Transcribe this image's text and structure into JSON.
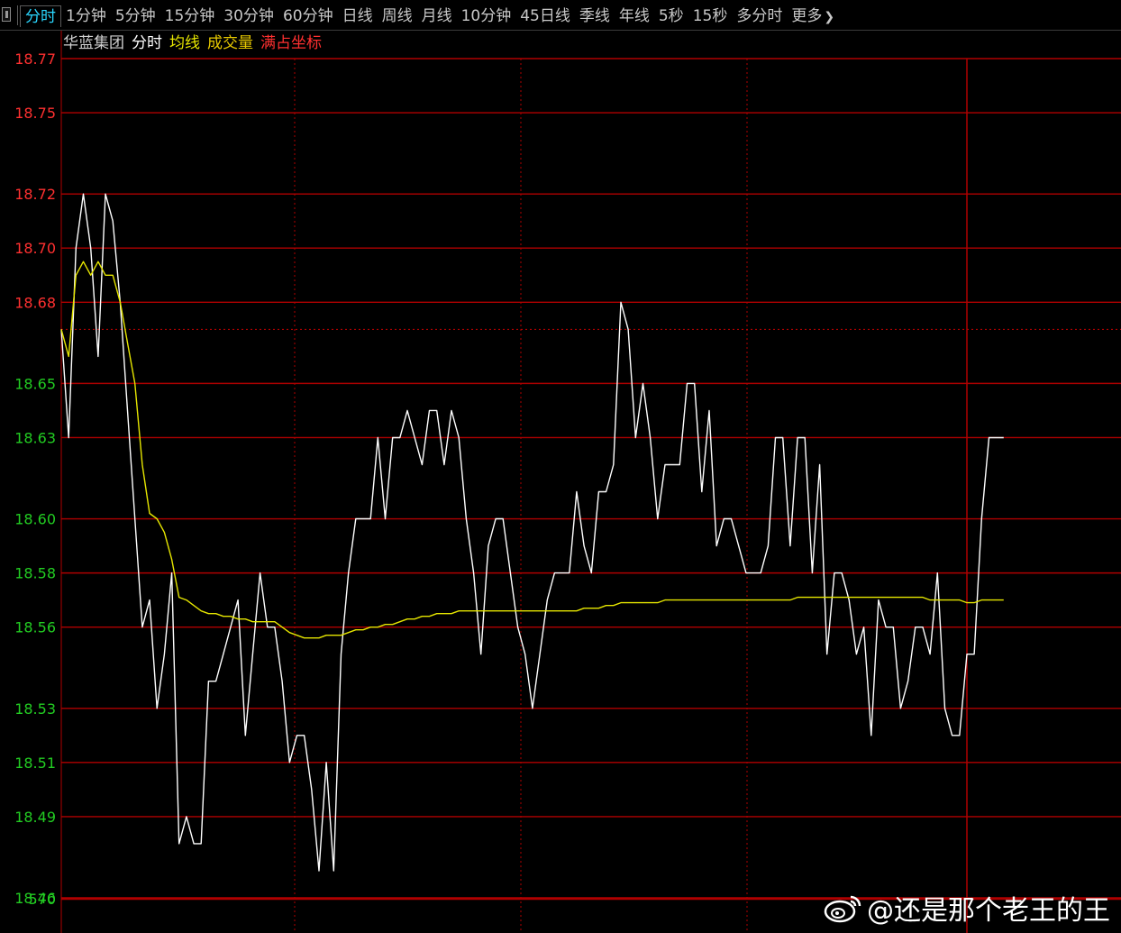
{
  "toolbar": {
    "tabs": [
      {
        "label": "分时",
        "active": true
      },
      {
        "label": "1分钟"
      },
      {
        "label": "5分钟"
      },
      {
        "label": "15分钟"
      },
      {
        "label": "30分钟"
      },
      {
        "label": "60分钟"
      },
      {
        "label": "日线"
      },
      {
        "label": "周线"
      },
      {
        "label": "月线"
      },
      {
        "label": "10分钟"
      },
      {
        "label": "45日线"
      },
      {
        "label": "季线"
      },
      {
        "label": "年线"
      },
      {
        "label": "5秒"
      },
      {
        "label": "15秒"
      },
      {
        "label": "多分时"
      },
      {
        "label": "更多",
        "chevron": true
      }
    ]
  },
  "legend": {
    "stock_name": "华蓝集团",
    "mode": "分时",
    "avg_line": "均线",
    "volume": "成交量",
    "scale": "满占坐标"
  },
  "colors": {
    "price_line": "#ffffff",
    "avg_line": "#e6e600",
    "grid": "#b00000",
    "up_label": "#ff3030",
    "down_label": "#22cc22",
    "ref_line": "#c80000"
  },
  "watermark": {
    "text": "@还是那个老王的王",
    "icon": "weibo-icon"
  },
  "chart_data": {
    "type": "line",
    "y_ticks": [
      {
        "label": "18.77",
        "value": 18.77,
        "color": "up"
      },
      {
        "label": "18.75",
        "value": 18.75,
        "color": "up"
      },
      {
        "label": "18.72",
        "value": 18.72,
        "color": "up"
      },
      {
        "label": "18.70",
        "value": 18.7,
        "color": "up"
      },
      {
        "label": "18.68",
        "value": 18.68,
        "color": "up"
      },
      {
        "label": "18.65",
        "value": 18.65,
        "color": "down"
      },
      {
        "label": "18.63",
        "value": 18.63,
        "color": "down"
      },
      {
        "label": "18.60",
        "value": 18.6,
        "color": "down"
      },
      {
        "label": "18.58",
        "value": 18.58,
        "color": "down"
      },
      {
        "label": "18.56",
        "value": 18.56,
        "color": "down"
      },
      {
        "label": "18.53",
        "value": 18.53,
        "color": "down"
      },
      {
        "label": "18.51",
        "value": 18.51,
        "color": "down"
      },
      {
        "label": "18.49",
        "value": 18.49,
        "color": "down"
      },
      {
        "label": "18.46",
        "value": 18.46,
        "color": "down"
      }
    ],
    "volume_label": "570",
    "ylim": [
      18.46,
      18.77
    ],
    "prev_close": 18.67,
    "x_count": 130,
    "series": [
      {
        "key": "price",
        "values": [
          18.67,
          18.63,
          18.7,
          18.72,
          18.7,
          18.66,
          18.72,
          18.71,
          18.68,
          18.64,
          18.6,
          18.56,
          18.57,
          18.53,
          18.55,
          18.58,
          18.48,
          18.49,
          18.48,
          18.48,
          18.54,
          18.54,
          18.55,
          18.56,
          18.57,
          18.52,
          18.55,
          18.58,
          18.56,
          18.56,
          18.54,
          18.51,
          18.52,
          18.52,
          18.5,
          18.47,
          18.51,
          18.47,
          18.55,
          18.58,
          18.6,
          18.6,
          18.6,
          18.63,
          18.6,
          18.63,
          18.63,
          18.64,
          18.63,
          18.62,
          18.64,
          18.64,
          18.62,
          18.64,
          18.63,
          18.6,
          18.58,
          18.55,
          18.59,
          18.6,
          18.6,
          18.58,
          18.56,
          18.55,
          18.53,
          18.55,
          18.57,
          18.58,
          18.58,
          18.58,
          18.61,
          18.59,
          18.58,
          18.61,
          18.61,
          18.62,
          18.68,
          18.67,
          18.63,
          18.65,
          18.63,
          18.6,
          18.62,
          18.62,
          18.62,
          18.65,
          18.65,
          18.61,
          18.64,
          18.59,
          18.6,
          18.6,
          18.59,
          18.58,
          18.58,
          18.58,
          18.59,
          18.63,
          18.63,
          18.59,
          18.63,
          18.63,
          18.58,
          18.62,
          18.55,
          18.58,
          18.58,
          18.57,
          18.55,
          18.56,
          18.52,
          18.57,
          18.56,
          18.56,
          18.53,
          18.54,
          18.56,
          18.56,
          18.55,
          18.58,
          18.53,
          18.52,
          18.52,
          18.55,
          18.55,
          18.6,
          18.63,
          18.63,
          18.63
        ]
      },
      {
        "key": "average",
        "values": [
          18.67,
          18.66,
          18.69,
          18.695,
          18.69,
          18.695,
          18.69,
          18.69,
          18.68,
          18.665,
          18.65,
          18.62,
          18.602,
          18.6,
          18.595,
          18.585,
          18.571,
          18.57,
          18.568,
          18.566,
          18.565,
          18.565,
          18.564,
          18.564,
          18.563,
          18.563,
          18.562,
          18.562,
          18.562,
          18.562,
          18.56,
          18.558,
          18.557,
          18.556,
          18.556,
          18.556,
          18.557,
          18.557,
          18.557,
          18.558,
          18.559,
          18.559,
          18.56,
          18.56,
          18.561,
          18.561,
          18.562,
          18.563,
          18.563,
          18.564,
          18.564,
          18.565,
          18.565,
          18.565,
          18.566,
          18.566,
          18.566,
          18.566,
          18.566,
          18.566,
          18.566,
          18.566,
          18.566,
          18.566,
          18.566,
          18.566,
          18.566,
          18.566,
          18.566,
          18.566,
          18.566,
          18.567,
          18.567,
          18.567,
          18.568,
          18.568,
          18.569,
          18.569,
          18.569,
          18.569,
          18.569,
          18.569,
          18.57,
          18.57,
          18.57,
          18.57,
          18.57,
          18.57,
          18.57,
          18.57,
          18.57,
          18.57,
          18.57,
          18.57,
          18.57,
          18.57,
          18.57,
          18.57,
          18.57,
          18.57,
          18.571,
          18.571,
          18.571,
          18.571,
          18.571,
          18.571,
          18.571,
          18.571,
          18.571,
          18.571,
          18.571,
          18.571,
          18.571,
          18.571,
          18.571,
          18.571,
          18.571,
          18.571,
          18.57,
          18.57,
          18.57,
          18.57,
          18.57,
          18.569,
          18.569,
          18.57,
          18.57,
          18.57,
          18.57
        ]
      }
    ]
  }
}
